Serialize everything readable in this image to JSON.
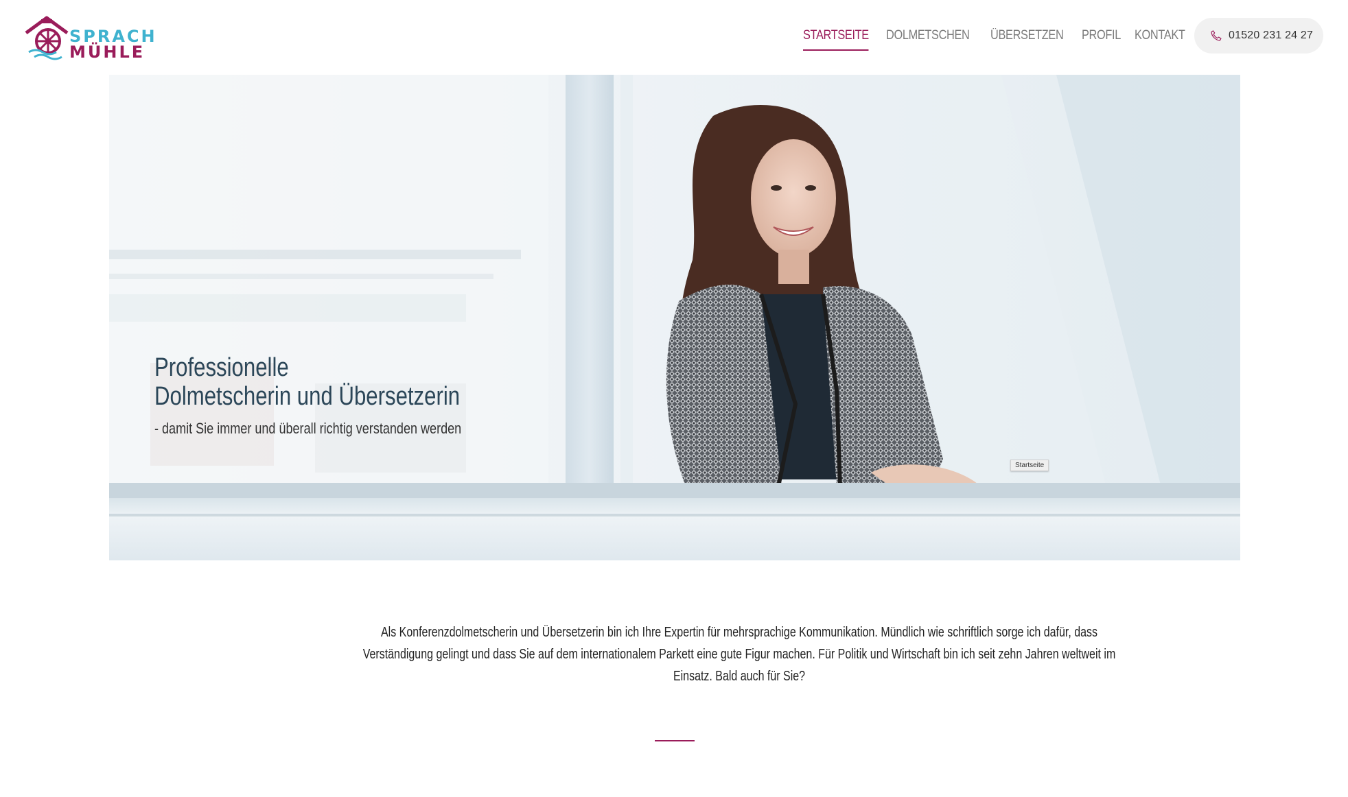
{
  "brand": {
    "logo_line_1": "SPRACH",
    "logo_line_2": "MÜHLE",
    "colors": {
      "teal": "#3fb2cf",
      "berry": "#9a1c5a"
    }
  },
  "nav": {
    "items": [
      {
        "label": "STARTSEITE",
        "active": true
      },
      {
        "label": "DOLMETSCHEN",
        "active": false
      },
      {
        "label": "ÜBERSETZEN",
        "active": false
      },
      {
        "label": "PROFIL",
        "active": false
      },
      {
        "label": "KONTAKT",
        "active": false
      }
    ],
    "phone": {
      "icon": "phone-icon",
      "number": "01520 231 24 27"
    }
  },
  "hero": {
    "headline_line_1": "Professionelle",
    "headline_line_2": "Dolmetscherin und Übersetzerin",
    "subline": "- damit Sie immer und überall richtig verstanden werden",
    "image_tag": "Startseite"
  },
  "intro": {
    "text": "Als Konferenzdolmetscherin und Übersetzerin bin ich Ihre Expertin für mehrsprachige Kommunikation. Mündlich wie schriftlich sorge ich dafür, dass Verständigung gelingt und dass Sie auf dem internationalem Parkett eine gute Figur machen. Für Politik und Wirtschaft bin ich seit zehn Jahren weltweit im Einsatz. Bald auch für Sie?"
  }
}
